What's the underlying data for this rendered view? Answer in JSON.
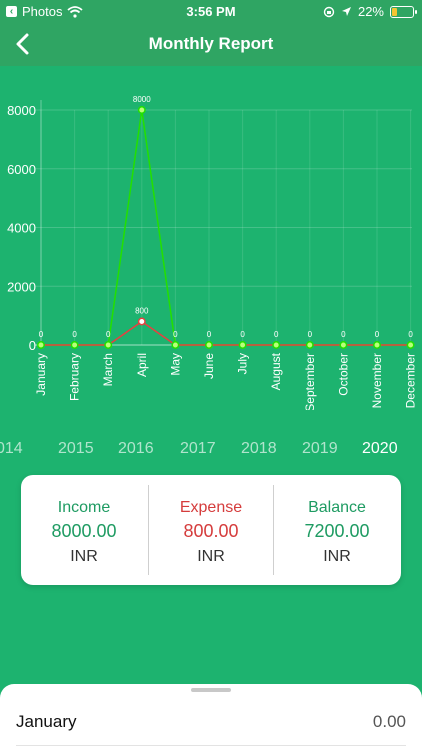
{
  "status_bar": {
    "back_app": "Photos",
    "time": "3:56 PM",
    "battery": "22%",
    "icons": [
      "wifi-icon",
      "orientation-lock-icon",
      "location-icon",
      "battery-icon"
    ]
  },
  "header": {
    "title": "Monthly Report"
  },
  "chart_data": {
    "type": "line",
    "categories": [
      "January",
      "February",
      "March",
      "April",
      "May",
      "June",
      "July",
      "August",
      "September",
      "October",
      "November",
      "December"
    ],
    "series": [
      {
        "color": "#23e000",
        "values": [
          0,
          0,
          0,
          8000,
          0,
          0,
          0,
          0,
          0,
          0,
          0,
          0
        ]
      },
      {
        "color": "#e84040",
        "values": [
          0,
          0,
          0,
          800,
          0,
          0,
          0,
          0,
          0,
          0,
          0,
          0
        ]
      }
    ],
    "point_labels": [
      "0",
      "0",
      "0",
      "8000",
      "0",
      "0",
      "0",
      "0",
      "0",
      "0",
      "0",
      "0"
    ],
    "expense_point_label": "800",
    "y_ticks": [
      "0",
      "2000",
      "4000",
      "6000",
      "8000"
    ],
    "ylim": [
      0,
      8000
    ],
    "grid": true
  },
  "years": {
    "items": [
      "014",
      "2015",
      "2016",
      "2017",
      "2018",
      "2019",
      "2020"
    ],
    "selected": "2020"
  },
  "summary": {
    "income": {
      "label": "Income",
      "value": "8000.00",
      "currency": "INR"
    },
    "expense": {
      "label": "Expense",
      "value": "800.00",
      "currency": "INR"
    },
    "balance": {
      "label": "Balance",
      "value": "7200.00",
      "currency": "INR"
    }
  },
  "colors": {
    "accent": "#1db36f",
    "income": "#1e9b62",
    "expense": "#d53c3c"
  },
  "list": {
    "rows": [
      {
        "month": "January",
        "amount": "0.00"
      }
    ]
  }
}
